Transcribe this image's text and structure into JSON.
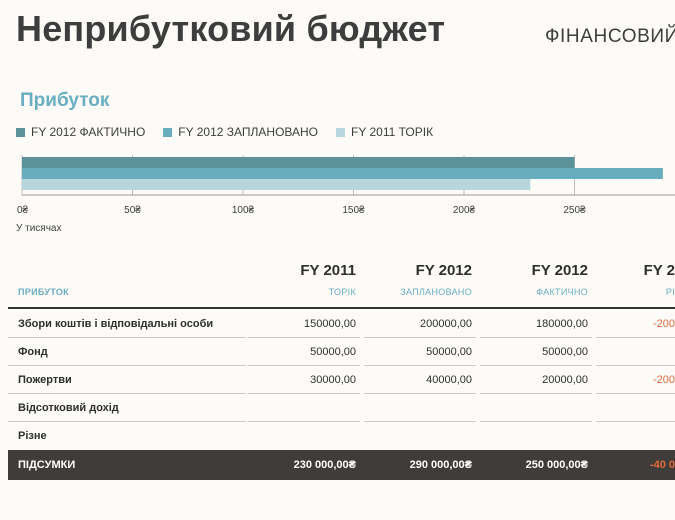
{
  "header": {
    "title": "Неприбутковий бюджет",
    "subtitle": "ФІНАНСОВИЙ"
  },
  "section": {
    "title": "Прибуток"
  },
  "colors": {
    "actual": "#5c9299",
    "planned": "#67adbd",
    "prev": "#b8d6de",
    "accent": "#6aaec1",
    "negative": "#e26b3f",
    "total_bg": "#403c39"
  },
  "chart_data": {
    "type": "bar",
    "orientation": "horizontal",
    "series": [
      {
        "name": "FY 2012 ФАКТИЧНО",
        "values": [
          250
        ]
      },
      {
        "name": "FY 2012 ЗАПЛАНОВАНО",
        "values": [
          290
        ]
      },
      {
        "name": "FY 2011 ТОРІК",
        "values": [
          230
        ]
      }
    ],
    "xticks": [
      "0₴",
      "50₴",
      "100₴",
      "150₴",
      "200₴",
      "250₴"
    ],
    "xlim": [
      0,
      290
    ],
    "unit_label": "У тисячах",
    "legend_position": "top-left"
  },
  "table": {
    "label_header": "ПРИБУТОК",
    "columns": [
      {
        "year": "FY 2011",
        "sub": "ТОРІК"
      },
      {
        "year": "FY 2012",
        "sub": "ЗАПЛАНОВАНО"
      },
      {
        "year": "FY 2012",
        "sub": "ФАКТИЧНО"
      },
      {
        "year": "FY 2",
        "sub": "РІ"
      }
    ],
    "rows": [
      {
        "label": "Збори коштів і відповідальні особи",
        "values": [
          "150000,00",
          "200000,00",
          "180000,00",
          "-200"
        ]
      },
      {
        "label": "Фонд",
        "values": [
          "50000,00",
          "50000,00",
          "50000,00",
          ""
        ]
      },
      {
        "label": "Пожертви",
        "values": [
          "30000,00",
          "40000,00",
          "20000,00",
          "-200"
        ]
      },
      {
        "label": "Відсотковий дохід",
        "values": [
          "",
          "",
          "",
          ""
        ]
      },
      {
        "label": "Різне",
        "values": [
          "",
          "",
          "",
          ""
        ]
      }
    ],
    "totals": {
      "label": "ПІДСУМКИ",
      "values": [
        "230 000,00₴",
        "290 000,00₴",
        "250 000,00₴",
        "-40 0"
      ]
    }
  }
}
